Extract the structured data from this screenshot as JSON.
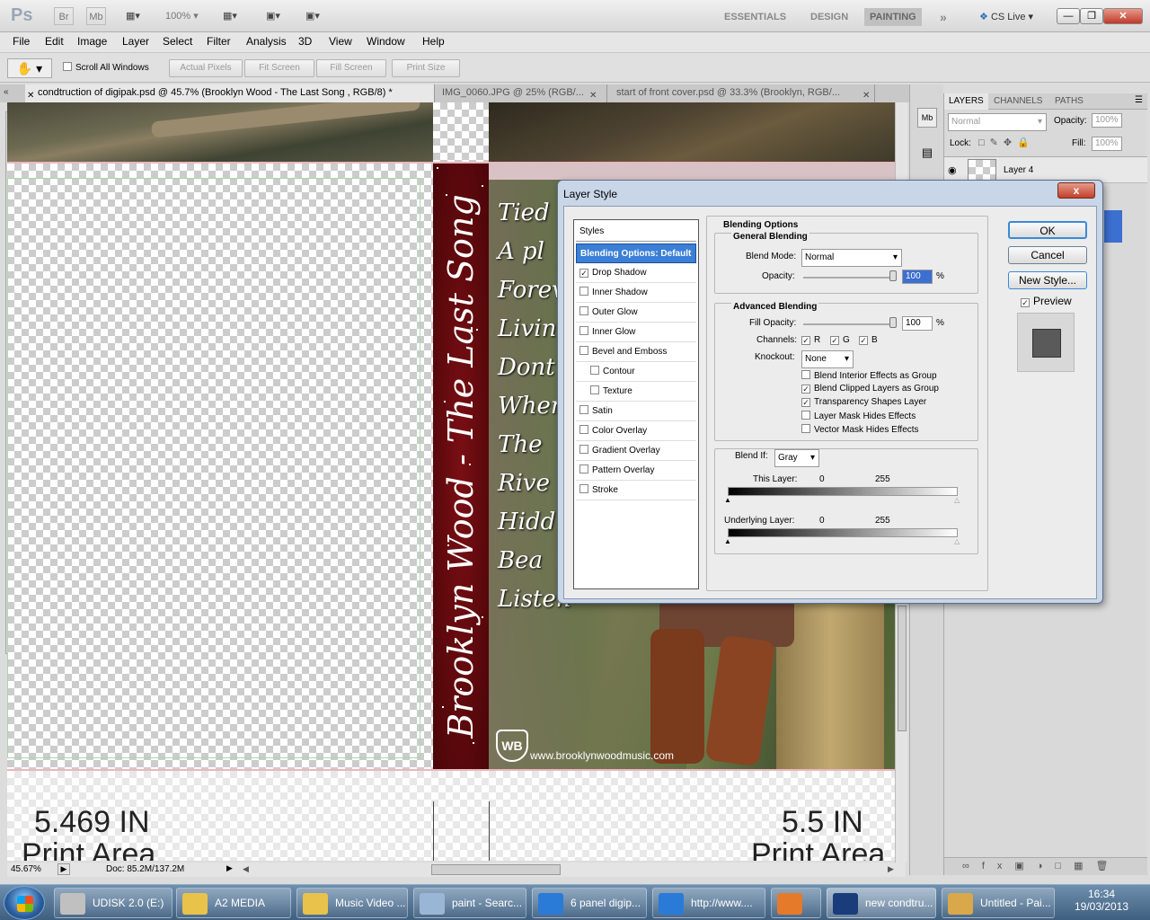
{
  "app": {
    "logo": "Ps",
    "br": "Br",
    "mb": "Mb",
    "zoom": "100%"
  },
  "workspaces": {
    "essentials": "ESSENTIALS",
    "design": "DESIGN",
    "painting": "PAINTING",
    "more": "»",
    "cslive": "CS Live"
  },
  "menu": [
    "File",
    "Edit",
    "Image",
    "Layer",
    "Select",
    "Filter",
    "Analysis",
    "3D",
    "View",
    "Window",
    "Help"
  ],
  "options": {
    "scroll_all": "Scroll All Windows",
    "actual": "Actual Pixels",
    "fit": "Fit Screen",
    "fill": "Fill Screen",
    "print": "Print Size"
  },
  "tabs": [
    {
      "label": "condtruction of digipak.psd @ 45.7% (Brooklyn Wood - The Last Song , RGB/8) *"
    },
    {
      "label": "IMG_0060.JPG @ 25% (RGB/..."
    },
    {
      "label": "start of front cover.psd @ 33.3% (Brooklyn, RGB/..."
    }
  ],
  "canvas": {
    "spine_text": "Brooklyn Wood - The Last Song",
    "tracks": [
      "Tied",
      "A pl",
      "Forev",
      "Livin",
      "Dont",
      "Wher",
      "The",
      "Rive",
      "Hidd",
      "Bea",
      "Listen"
    ],
    "logo": "WB",
    "website": "www.brooklynwoodmusic.com",
    "measure_left": "5.469 IN",
    "measure_right": "5.5 IN",
    "print_area": "Print Area"
  },
  "status": {
    "zoom": "45.67%",
    "doc": "Doc: 85.2M/137.2M"
  },
  "panels": {
    "tabs": [
      "LAYERS",
      "CHANNELS",
      "PATHS"
    ],
    "blend": "Normal",
    "opacity_label": "Opacity:",
    "opacity": "100%",
    "lock_label": "Lock:",
    "fill_label": "Fill:",
    "fill": "100%",
    "layer_name": "Layer 4"
  },
  "dialog": {
    "title": "Layer Style",
    "close": "x",
    "styles_header": "Styles",
    "styles": [
      {
        "label": "Blending Options: Default",
        "check": false,
        "selected": true,
        "indent": false
      },
      {
        "label": "Drop Shadow",
        "check": true,
        "checked": true,
        "indent": false
      },
      {
        "label": "Inner Shadow",
        "check": true,
        "checked": false,
        "indent": false
      },
      {
        "label": "Outer Glow",
        "check": true,
        "checked": false,
        "indent": false
      },
      {
        "label": "Inner Glow",
        "check": true,
        "checked": false,
        "indent": false
      },
      {
        "label": "Bevel and Emboss",
        "check": true,
        "checked": false,
        "indent": false
      },
      {
        "label": "Contour",
        "check": true,
        "checked": false,
        "indent": true
      },
      {
        "label": "Texture",
        "check": true,
        "checked": false,
        "indent": true
      },
      {
        "label": "Satin",
        "check": true,
        "checked": false,
        "indent": false
      },
      {
        "label": "Color Overlay",
        "check": true,
        "checked": false,
        "indent": false
      },
      {
        "label": "Gradient Overlay",
        "check": true,
        "checked": false,
        "indent": false
      },
      {
        "label": "Pattern Overlay",
        "check": true,
        "checked": false,
        "indent": false
      },
      {
        "label": "Stroke",
        "check": true,
        "checked": false,
        "indent": false
      }
    ],
    "blending_options": "Blending Options",
    "general_blending": "General Blending",
    "blend_mode_label": "Blend Mode:",
    "blend_mode": "Normal",
    "opacity_label": "Opacity:",
    "opacity": "100",
    "percent": "%",
    "advanced_blending": "Advanced Blending",
    "fill_opacity_label": "Fill Opacity:",
    "fill_opacity": "100",
    "channels_label": "Channels:",
    "ch_r": "R",
    "ch_g": "G",
    "ch_b": "B",
    "knockout_label": "Knockout:",
    "knockout": "None",
    "adv_options": [
      {
        "label": "Blend Interior Effects as Group",
        "checked": false
      },
      {
        "label": "Blend Clipped Layers as Group",
        "checked": true
      },
      {
        "label": "Transparency Shapes Layer",
        "checked": true
      },
      {
        "label": "Layer Mask Hides Effects",
        "checked": false
      },
      {
        "label": "Vector Mask Hides Effects",
        "checked": false
      }
    ],
    "blend_if_label": "Blend If:",
    "blend_if": "Gray",
    "this_layer": "This Layer:",
    "underlying": "Underlying Layer:",
    "range_min": "0",
    "range_max": "255",
    "ok": "OK",
    "cancel": "Cancel",
    "new_style": "New Style...",
    "preview": "Preview"
  },
  "taskbar": {
    "items": [
      "UDISK 2.0 (E:)",
      "A2 MEDIA",
      "Music Video ...",
      "paint - Searc...",
      "6 panel digip...",
      "http://www....",
      "",
      "new condtru...",
      "Untitled - Pai..."
    ],
    "time": "16:34",
    "date": "19/03/2013"
  }
}
